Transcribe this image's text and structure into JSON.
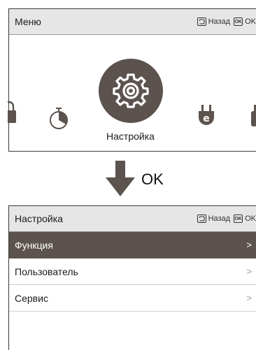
{
  "menu_panel": {
    "title": "Меню",
    "back_label": "Назад",
    "ok_label": "OK",
    "ok_key": "OK",
    "selected_label": "Настройка",
    "icons": [
      "lock-icon",
      "timer-icon",
      "gear-icon",
      "plug-icon",
      "partial-icon"
    ]
  },
  "transition": {
    "label": "OK"
  },
  "settings_panel": {
    "title": "Настройка",
    "back_label": "Назад",
    "ok_label": "OK",
    "ok_key": "OK",
    "items": [
      {
        "label": "Функция",
        "chevron": ">",
        "selected": true
      },
      {
        "label": "Пользователь",
        "chevron": ">",
        "selected": false
      },
      {
        "label": "Сервис",
        "chevron": ">",
        "selected": false
      }
    ]
  },
  "colors": {
    "selected_bg": "#5c534e",
    "header_bg": "#e6e6e6",
    "icon_gray": "#5c534e"
  }
}
